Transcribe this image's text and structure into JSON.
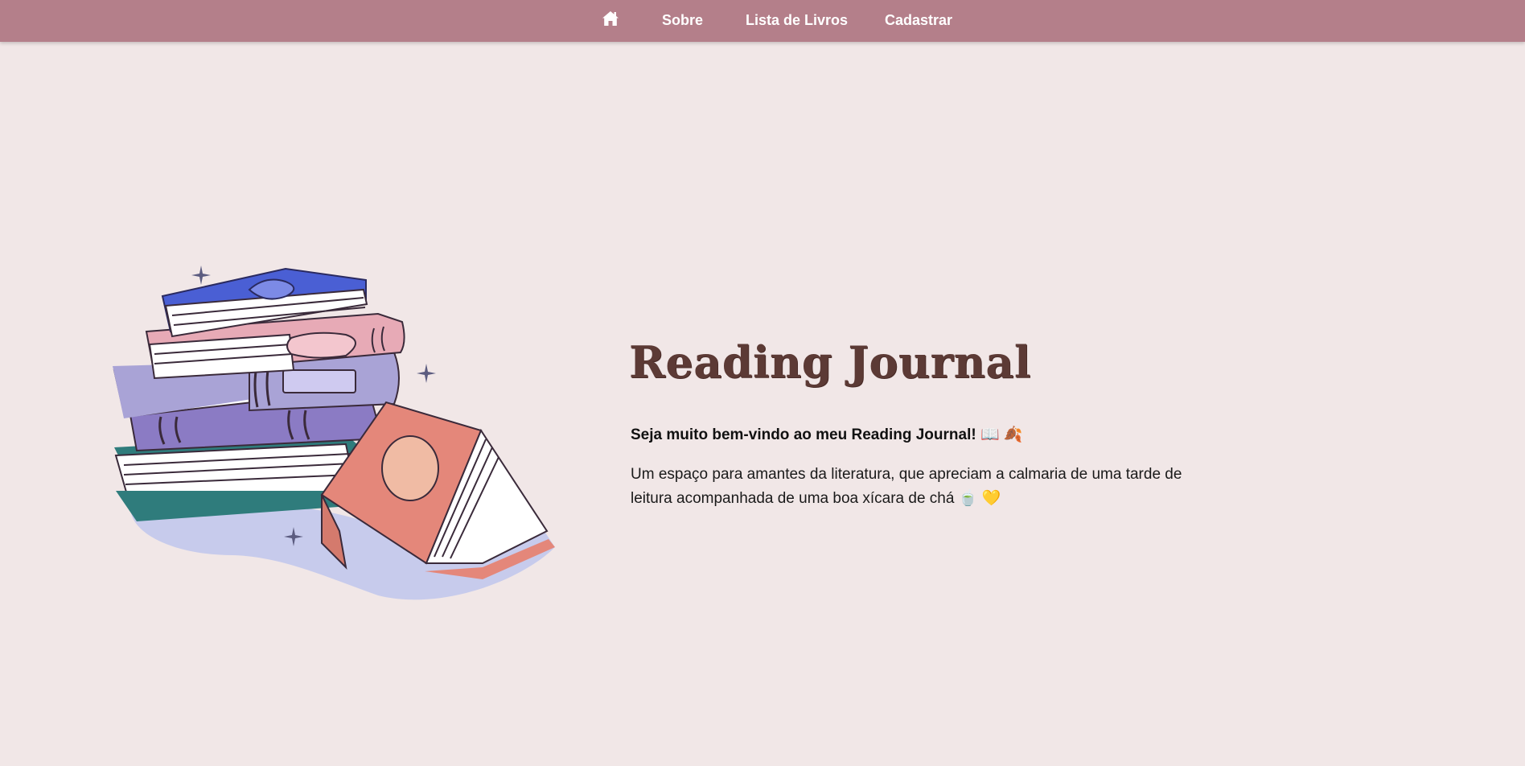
{
  "nav": {
    "home_icon": "home-icon",
    "items": [
      {
        "label": "Sobre"
      },
      {
        "label": "Lista de Livros"
      },
      {
        "label": "Cadastrar"
      }
    ],
    "background": "#b47f8a"
  },
  "hero": {
    "image": "book-stack-illustration",
    "title": "Reading Journal",
    "welcome": "Seja muito bem-vindo ao meu Reading Journal!",
    "welcome_emoji": "📖 🍂",
    "description": "Um espaço para amantes da literatura, que apreciam a calmaria de uma tarde de leitura acompanhada de uma boa xícara de chá 🍵 💛"
  },
  "colors": {
    "page_background": "#f1e7e7",
    "title": "#5c3a35"
  }
}
